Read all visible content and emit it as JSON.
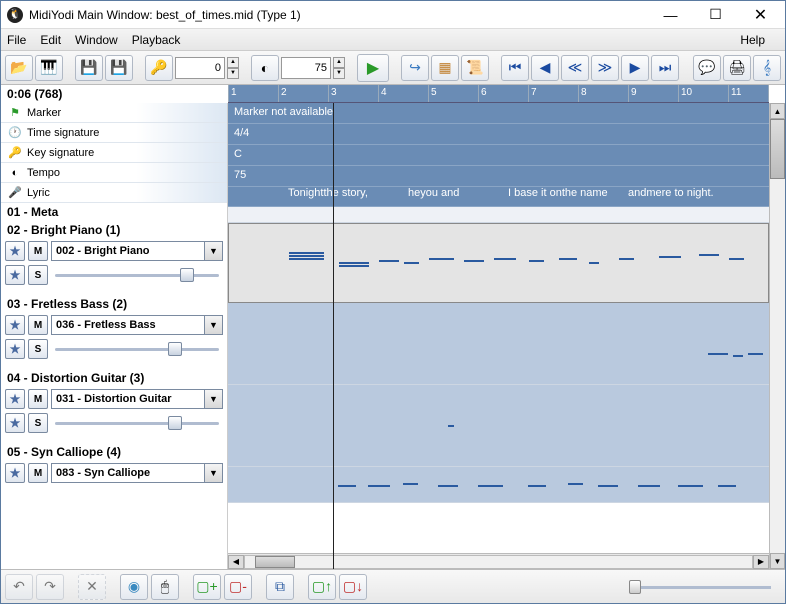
{
  "window": {
    "title": "MidiYodi Main Window: best_of_times.mid (Type 1)"
  },
  "menu": {
    "file": "File",
    "edit": "Edit",
    "window": "Window",
    "playback": "Playback",
    "help": "Help"
  },
  "toolbar": {
    "num1": "0",
    "num2": "75"
  },
  "timepos": "0:06 (768)",
  "ruler": [
    "1",
    "2",
    "3",
    "4",
    "5",
    "6",
    "7",
    "8",
    "9",
    "10",
    "11",
    "1"
  ],
  "info": {
    "marker_label": "Marker",
    "timesig_label": "Time signature",
    "keysig_label": "Key signature",
    "tempo_label": "Tempo",
    "lyric_label": "Lyric",
    "marker_val": "Marker not available",
    "timesig_val": "4/4",
    "keysig_val": "C",
    "tempo_val": "75",
    "lyric_snips": [
      "Tonightthe story,",
      "heyou and",
      "I base it onthe name",
      "andmere to night."
    ]
  },
  "tracks": [
    {
      "header": "01 - Meta"
    },
    {
      "header": "02 - Bright Piano (1)",
      "instrument": "002 - Bright Piano",
      "selected": true
    },
    {
      "header": "03 - Fretless Bass (2)",
      "instrument": "036 - Fretless Bass"
    },
    {
      "header": "04 - Distortion Guitar (3)",
      "instrument": "031 - Distortion Guitar"
    },
    {
      "header": "05 - Syn Calliope (4)",
      "instrument": "083 - Syn Calliope"
    }
  ],
  "buttons": {
    "m": "M",
    "s": "S"
  }
}
